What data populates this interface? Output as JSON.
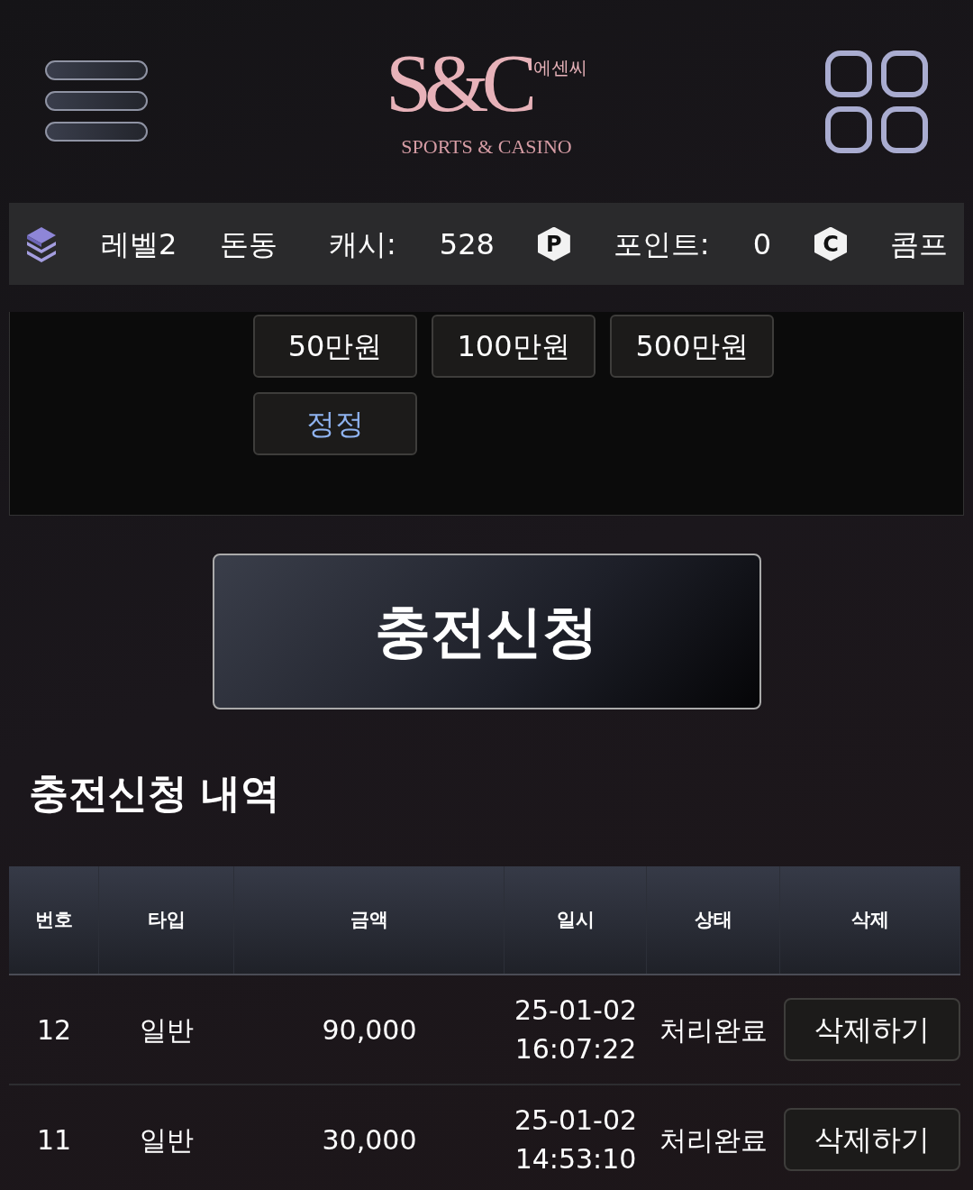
{
  "header": {
    "logo": {
      "brand": "S&C",
      "korean": "에센씨",
      "tagline": "SPORTS & CASINO"
    }
  },
  "status_bar": {
    "level": "레벨2",
    "username": "돈동",
    "cash_label": "캐시:",
    "cash": "528",
    "point_badge": "P",
    "point_label": "포인트:",
    "points": "0",
    "comp_badge": "C",
    "comp_label": "콤프"
  },
  "amount_buttons": [
    {
      "label": "50만원",
      "kind": "amount"
    },
    {
      "label": "100만원",
      "kind": "amount"
    },
    {
      "label": "500만원",
      "kind": "amount"
    },
    {
      "label": "정정",
      "kind": "reset"
    }
  ],
  "submit_button": "충전신청",
  "history": {
    "title": "충전신청 내역",
    "columns": [
      "번호",
      "타입",
      "금액",
      "일시",
      "상태",
      "삭제"
    ],
    "rows": [
      {
        "no": "12",
        "type": "일반",
        "amount": "90,000",
        "date": "25-01-02",
        "time": "16:07:22",
        "status": "처리완료",
        "action": "삭제하기"
      },
      {
        "no": "11",
        "type": "일반",
        "amount": "30,000",
        "date": "25-01-02",
        "time": "14:53:10",
        "status": "처리완료",
        "action": "삭제하기"
      }
    ]
  }
}
